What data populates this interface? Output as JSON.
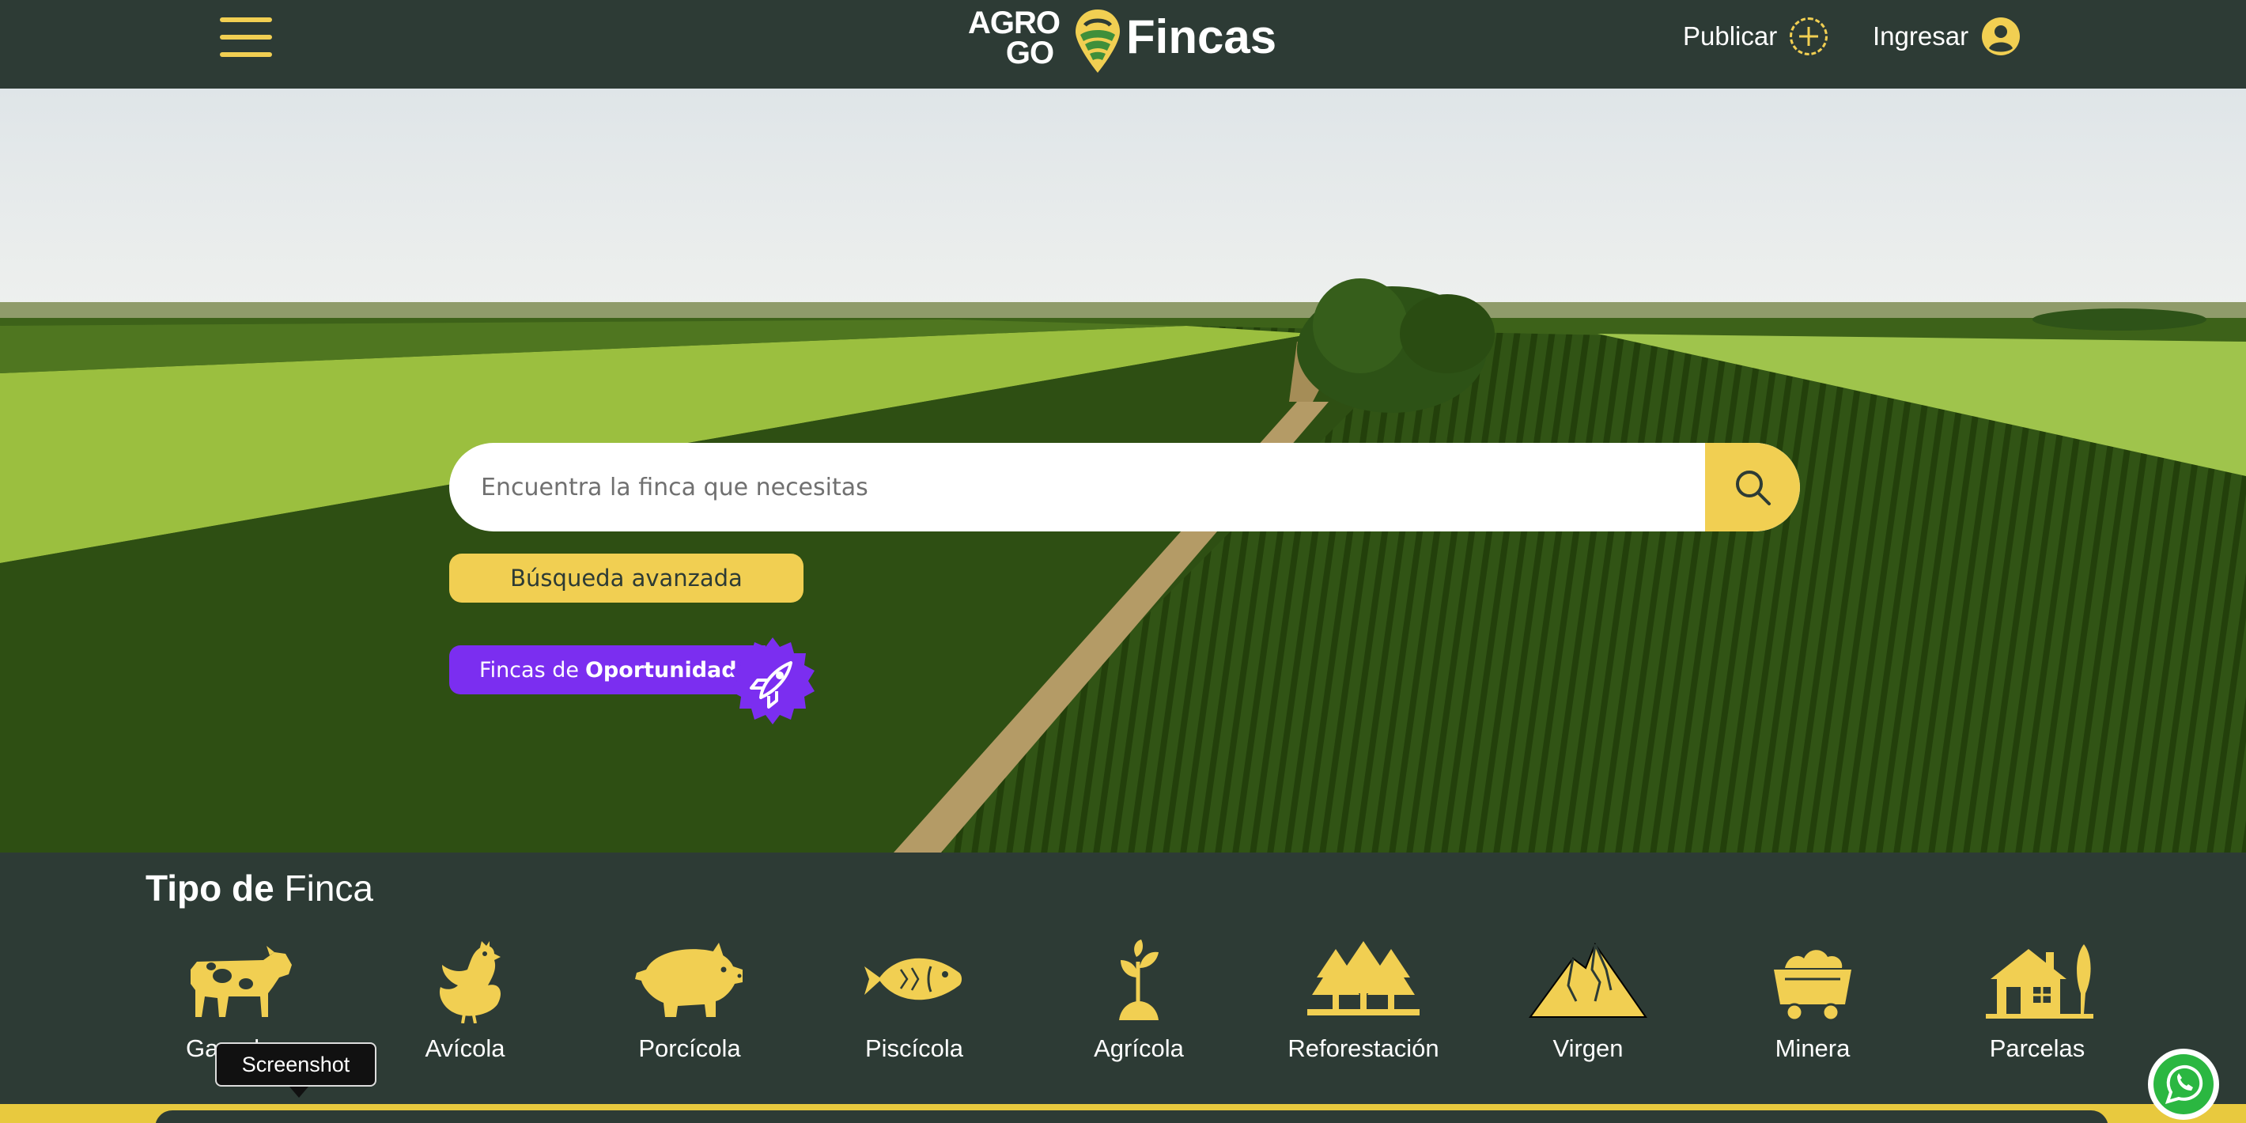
{
  "header": {
    "logo_agro_line1": "AGRO",
    "logo_agro_line2": "GO",
    "logo_fincas": "Fincas",
    "publicar_label": "Publicar",
    "ingresar_label": "Ingresar"
  },
  "hero": {
    "search_placeholder": "Encuentra la finca que necesitas",
    "advanced_search_label": "Búsqueda avanzada",
    "opportunity_prefix": "Fincas de",
    "opportunity_bold": "Oportunidad"
  },
  "tipo_finca": {
    "title_bold": "Tipo de",
    "title_regular": "Finca",
    "types": [
      {
        "label": "Ganadera",
        "icon": "cow-icon"
      },
      {
        "label": "Avícola",
        "icon": "chicken-icon"
      },
      {
        "label": "Porcícola",
        "icon": "pig-icon"
      },
      {
        "label": "Piscícola",
        "icon": "fish-icon"
      },
      {
        "label": "Agrícola",
        "icon": "sprout-icon"
      },
      {
        "label": "Reforestación",
        "icon": "trees-icon"
      },
      {
        "label": "Virgen",
        "icon": "mountain-icon"
      },
      {
        "label": "Minera",
        "icon": "mine-cart-icon"
      },
      {
        "label": "Parcelas",
        "icon": "house-icon"
      }
    ]
  },
  "tooltip": {
    "text": "Screenshot"
  },
  "colors": {
    "dark_green": "#2d3b35",
    "accent_yellow": "#f1cf52",
    "opportunity_purple": "#7b2ef0"
  }
}
